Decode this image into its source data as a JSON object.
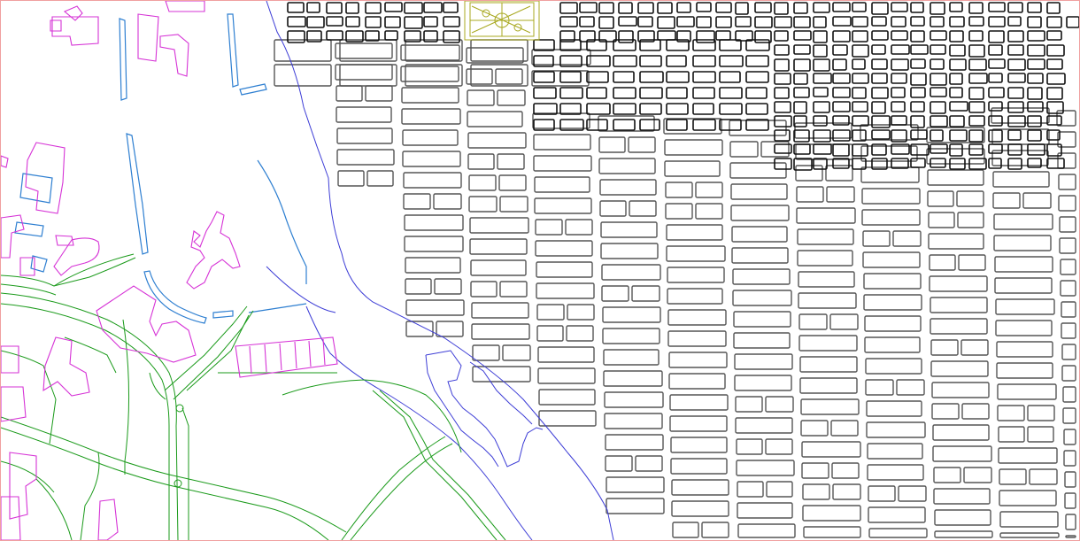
{
  "map": {
    "layers": [
      {
        "id": "street-blocks",
        "color": "#555555"
      },
      {
        "id": "dense-downtown",
        "color": "#111111"
      },
      {
        "id": "river",
        "color": "#3d3dd6"
      },
      {
        "id": "highways",
        "color": "#1a9a1a"
      },
      {
        "id": "buildings",
        "color": "#d633d6"
      },
      {
        "id": "water-edges",
        "color": "#2e7fd1"
      },
      {
        "id": "park",
        "color": "#a8a820"
      }
    ],
    "frame_color": "#f0a0a0"
  }
}
